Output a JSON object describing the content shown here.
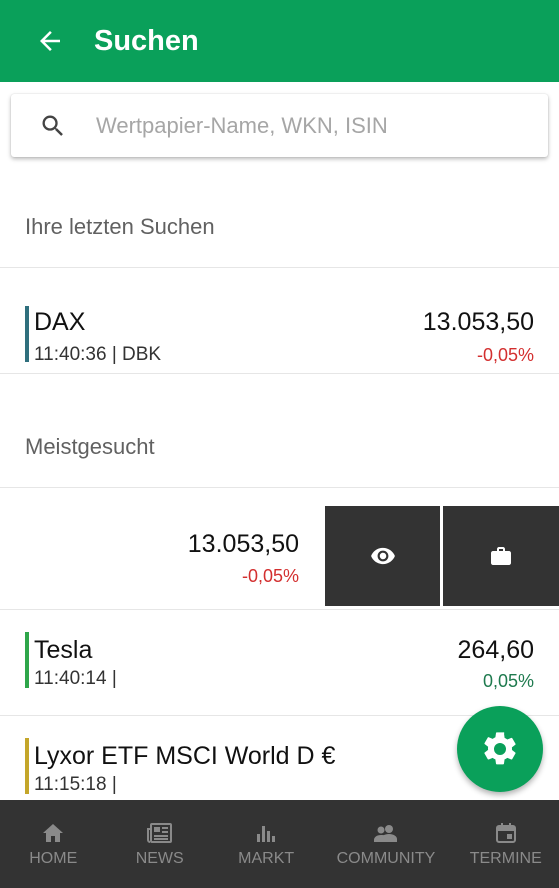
{
  "appbar": {
    "title": "Suchen",
    "color": "#0aa05a"
  },
  "search": {
    "placeholder": "Wertpapier-Name, WKN, ISIN",
    "value": ""
  },
  "recent": {
    "header": "Ihre letzten Suchen",
    "items": [
      {
        "name": "DAX",
        "meta": "11:40:36 | DBK",
        "value": "13.053,50",
        "change": "-0,05%",
        "bar_color": "#2f6f7d",
        "change_color": "#d32f2f"
      }
    ]
  },
  "popular": {
    "header": "Meistgesucht",
    "items": [
      {
        "name": "",
        "meta": "",
        "value": "13.053,50",
        "change": "-0,05%",
        "bar_color": "#2f6f7d",
        "change_color": "#d32f2f",
        "actions": [
          "eye-icon",
          "briefcase-icon"
        ]
      },
      {
        "name": "Tesla",
        "meta": "11:40:14 |",
        "value": "264,60",
        "change": "0,05%",
        "bar_color": "#2ea64a",
        "change_color": "#1e7a4e"
      },
      {
        "name": "Lyxor ETF MSCI World D €",
        "meta": "11:15:18 |",
        "value": "",
        "change": "",
        "bar_color": "#c4a62a",
        "change_color": "#1e7a4e"
      }
    ]
  },
  "nav": [
    {
      "label": "HOME",
      "icon": "home-icon"
    },
    {
      "label": "NEWS",
      "icon": "newspaper-icon"
    },
    {
      "label": "MARKT",
      "icon": "bar-chart-icon"
    },
    {
      "label": "COMMUNITY",
      "icon": "people-icon"
    },
    {
      "label": "TERMINE",
      "icon": "calendar-icon"
    }
  ],
  "fab": {
    "icon": "gear-icon"
  }
}
